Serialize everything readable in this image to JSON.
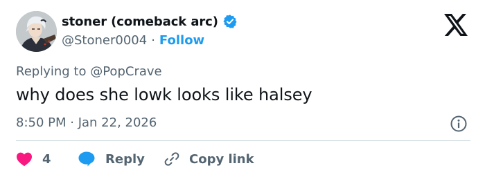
{
  "author": {
    "display_name": "stoner (comeback arc)",
    "handle": "@Stoner0004",
    "separator": "·",
    "follow_label": "Follow",
    "verified": true,
    "avatar_icon": "anime-avatar-icon"
  },
  "brand": {
    "logo_icon": "x-logo-icon"
  },
  "tweet": {
    "reply_prefix": "Replying to",
    "reply_mention": "@PopCrave",
    "text": "why does she lowk looks like halsey",
    "timestamp": "8:50 PM · Jan 22, 2026"
  },
  "actions": {
    "like_count": "4",
    "reply_label": "Reply",
    "copy_link_label": "Copy link"
  },
  "colors": {
    "accent": "#1d9bf0",
    "like": "#f91880",
    "secondary_text": "#536471",
    "primary_text": "#0f1419",
    "divider": "#cfd9de"
  }
}
